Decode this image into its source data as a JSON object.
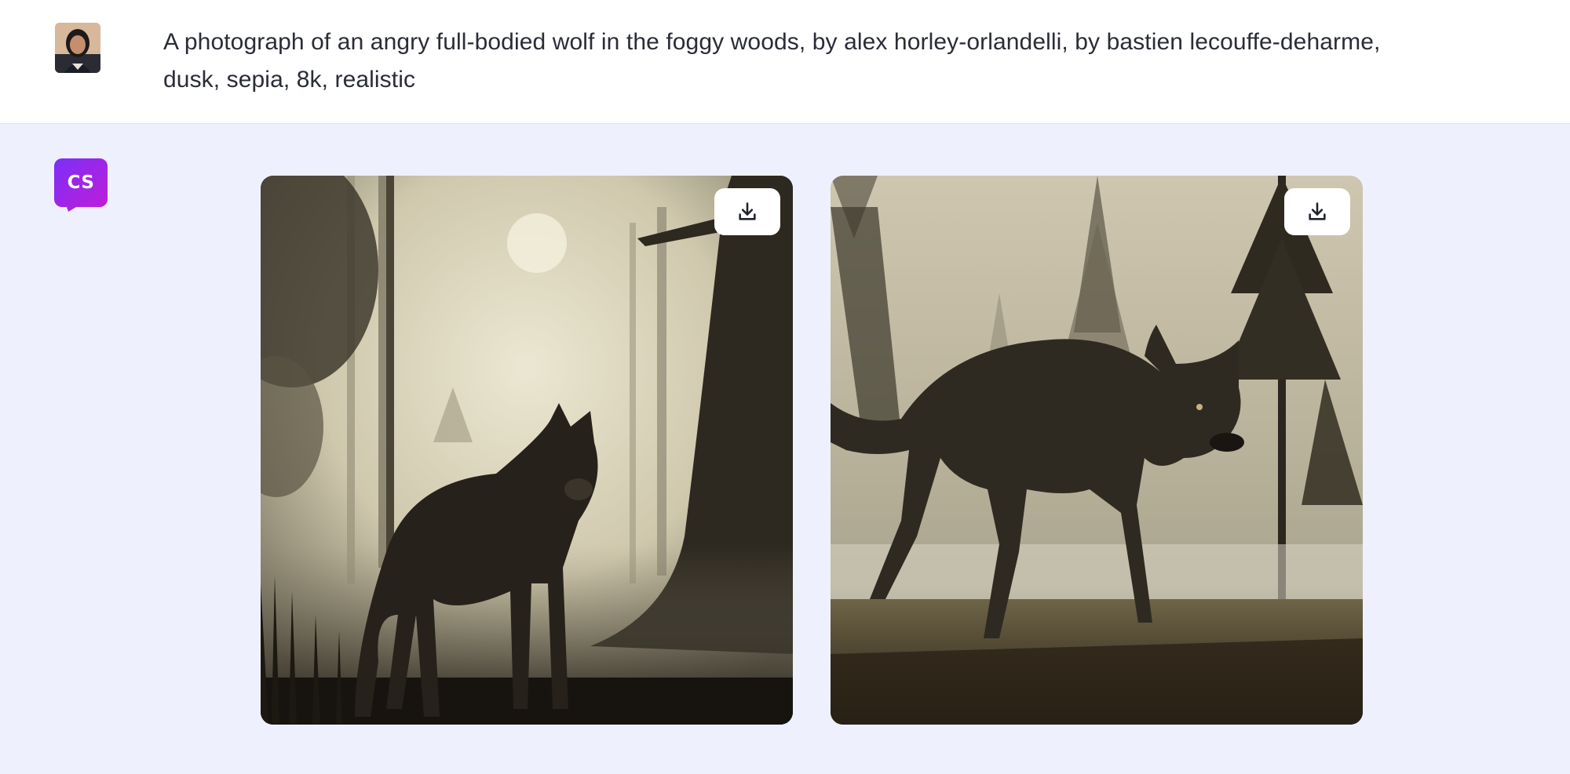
{
  "user_message": {
    "avatar": "user-avatar-photo",
    "prompt": "A photograph of an angry full-bodied wolf in the foggy woods, by alex horley-orlandelli, by bastien lecouffe-deharme, dusk, sepia, 8k, realistic"
  },
  "bot_message": {
    "logo_text": "CS",
    "logo_colors": [
      "#7b2ff7",
      "#c21cd8"
    ],
    "images": [
      {
        "subject": "wolf standing in foggy forest, sepia",
        "download_icon": "download-icon"
      },
      {
        "subject": "snarling wolf walking through misty pine woods, sepia",
        "download_icon": "download-icon"
      }
    ]
  },
  "colors": {
    "page_background": "#eef1fd",
    "user_row_background": "#ffffff",
    "text": "#2a2d36"
  }
}
